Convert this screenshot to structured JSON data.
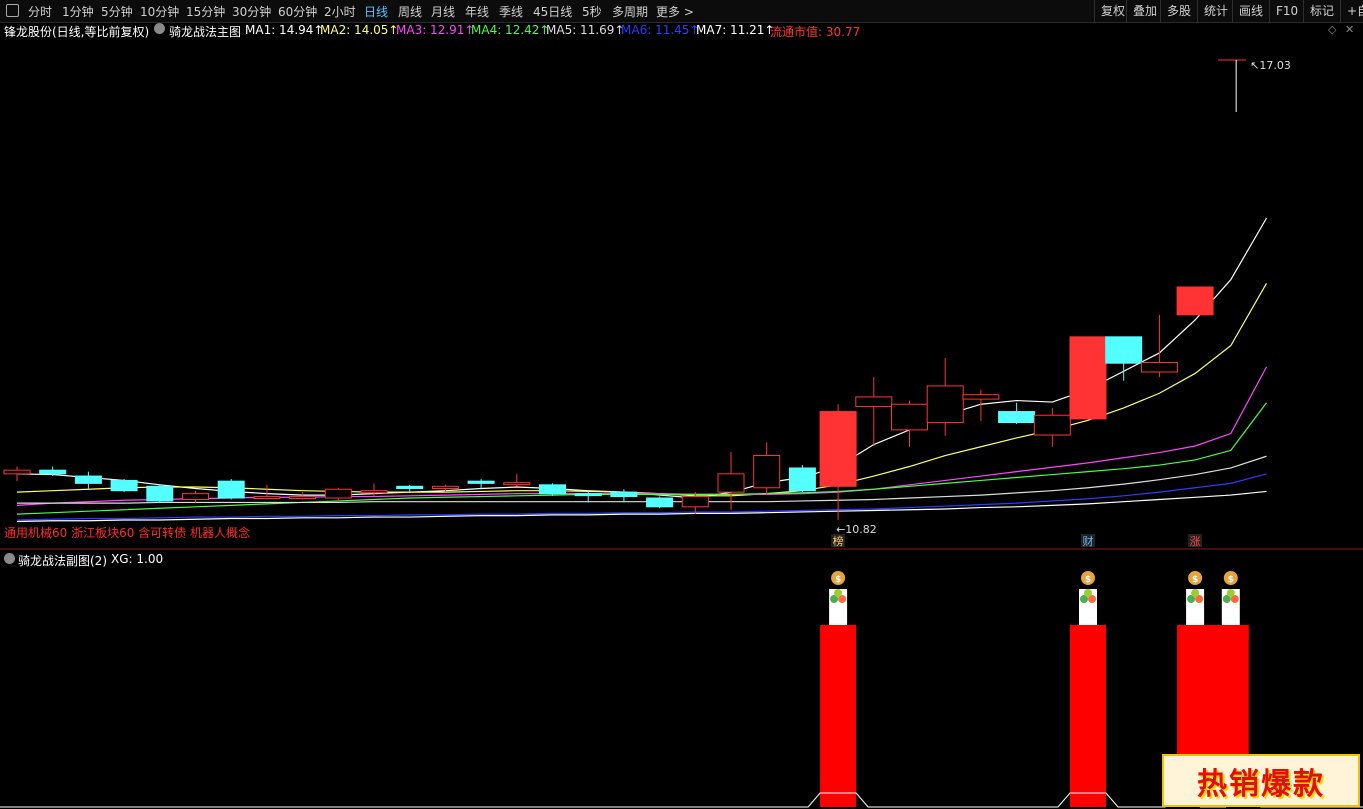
{
  "toolbar": {
    "periods": [
      "分时",
      "1分钟",
      "5分钟",
      "10分钟",
      "15分钟",
      "30分钟",
      "60分钟",
      "2小时",
      "日线",
      "周线",
      "月线",
      "年线",
      "季线",
      "45日线",
      "5秒",
      "多周期",
      "更多 >"
    ],
    "active_period": "日线",
    "right_buttons": [
      "复权",
      "叠加",
      "多股",
      "统计",
      "画线",
      "F10",
      "标记",
      "+自"
    ]
  },
  "info_bar": {
    "stock_title": "锋龙股份(日线,等比前复权)",
    "indicator_name": "骑龙战法主图",
    "ma": [
      {
        "label": "MA1: 14.94↑",
        "color": "#ffffff"
      },
      {
        "label": "MA2: 14.05↑",
        "color": "#ffff66"
      },
      {
        "label": "MA3: 12.91↑",
        "color": "#ff44ff"
      },
      {
        "label": "MA4: 12.42↑",
        "color": "#44ff44"
      },
      {
        "label": "MA5: 11.69↑",
        "color": "#dddddd"
      },
      {
        "label": "MA6: 11.45↑",
        "color": "#2a3cff"
      },
      {
        "label": "MA7: 11.21↑",
        "color": "#ffffff"
      },
      {
        "label": "流通市值: 30.77",
        "color": "#ff3333"
      }
    ]
  },
  "main_chart": {
    "concepts_text": "通用机械60 浙江板块60 含可转债 机器人概念",
    "high_label": "17.03",
    "low_label": "10.82",
    "markers": [
      {
        "text": "榜",
        "index": 23
      },
      {
        "text": "财",
        "index": 30
      },
      {
        "text": "涨",
        "index": 33
      }
    ]
  },
  "sub_header": {
    "title": "骑龙战法副图(2)",
    "xg_label": "XG: 1.00"
  },
  "badge": {
    "text": "热销爆款"
  },
  "colors": {
    "up": "#ff3333",
    "down": "#54ffff",
    "bar_red": "#ff0000"
  },
  "chart_data": [
    {
      "type": "candlestick",
      "title": "骑龙战法主图",
      "ylim": [
        10.5,
        17.3
      ],
      "candles": [
        {
          "o": 11.45,
          "h": 11.55,
          "l": 11.35,
          "c": 11.5
        },
        {
          "o": 11.5,
          "h": 11.55,
          "l": 11.42,
          "c": 11.45
        },
        {
          "o": 11.42,
          "h": 11.48,
          "l": 11.25,
          "c": 11.32
        },
        {
          "o": 11.36,
          "h": 11.38,
          "l": 11.2,
          "c": 11.22
        },
        {
          "o": 11.28,
          "h": 11.3,
          "l": 11.05,
          "c": 11.08
        },
        {
          "o": 11.1,
          "h": 11.22,
          "l": 11.05,
          "c": 11.18
        },
        {
          "o": 11.35,
          "h": 11.38,
          "l": 11.1,
          "c": 11.12
        },
        {
          "o": 11.12,
          "h": 11.3,
          "l": 11.1,
          "c": 11.14
        },
        {
          "o": 11.12,
          "h": 11.2,
          "l": 11.1,
          "c": 11.14
        },
        {
          "o": 11.12,
          "h": 11.26,
          "l": 11.08,
          "c": 11.24
        },
        {
          "o": 11.22,
          "h": 11.32,
          "l": 11.15,
          "c": 11.22
        },
        {
          "o": 11.28,
          "h": 11.3,
          "l": 11.2,
          "c": 11.25
        },
        {
          "o": 11.25,
          "h": 11.3,
          "l": 11.2,
          "c": 11.28
        },
        {
          "o": 11.35,
          "h": 11.38,
          "l": 11.25,
          "c": 11.32
        },
        {
          "o": 11.33,
          "h": 11.45,
          "l": 11.28,
          "c": 11.33
        },
        {
          "o": 11.3,
          "h": 11.32,
          "l": 11.15,
          "c": 11.18
        },
        {
          "o": 11.18,
          "h": 11.22,
          "l": 11.06,
          "c": 11.17
        },
        {
          "o": 11.2,
          "h": 11.24,
          "l": 11.06,
          "c": 11.14
        },
        {
          "o": 11.12,
          "h": 11.14,
          "l": 10.98,
          "c": 11.0
        },
        {
          "o": 11.0,
          "h": 11.2,
          "l": 10.9,
          "c": 11.14
        },
        {
          "o": 11.2,
          "h": 11.75,
          "l": 10.96,
          "c": 11.45
        },
        {
          "o": 11.26,
          "h": 11.88,
          "l": 11.16,
          "c": 11.7
        },
        {
          "o": 11.53,
          "h": 11.57,
          "l": 11.2,
          "c": 11.22
        },
        {
          "o": 11.28,
          "h": 12.4,
          "l": 10.82,
          "c": 12.3
        },
        {
          "o": 12.37,
          "h": 12.77,
          "l": 11.83,
          "c": 12.5
        },
        {
          "o": 12.05,
          "h": 12.45,
          "l": 11.82,
          "c": 12.4
        },
        {
          "o": 12.15,
          "h": 13.03,
          "l": 11.97,
          "c": 12.65
        },
        {
          "o": 12.47,
          "h": 12.6,
          "l": 12.17,
          "c": 12.53
        },
        {
          "o": 12.3,
          "h": 12.42,
          "l": 12.13,
          "c": 12.15
        },
        {
          "o": 11.98,
          "h": 12.35,
          "l": 11.82,
          "c": 12.25
        },
        {
          "o": 12.2,
          "h": 13.32,
          "l": 12.2,
          "c": 13.32
        },
        {
          "o": 13.32,
          "h": 13.32,
          "l": 12.72,
          "c": 12.96
        },
        {
          "o": 12.84,
          "h": 13.62,
          "l": 12.77,
          "c": 12.97
        },
        {
          "o": 13.62,
          "h": 14.0,
          "l": 13.62,
          "c": 14.0
        }
      ],
      "post_high": 17.03,
      "ma_series": [
        {
          "name": "MA1",
          "color": "#ffffff",
          "values": [
            11.45,
            11.44,
            11.4,
            11.36,
            11.3,
            11.25,
            11.21,
            11.18,
            11.16,
            11.16,
            11.18,
            11.2,
            11.22,
            11.25,
            11.27,
            11.25,
            11.22,
            11.2,
            11.16,
            11.12,
            11.2,
            11.33,
            11.4,
            11.55,
            11.85,
            12.05,
            12.25,
            12.4,
            12.45,
            12.43,
            12.6,
            12.85,
            13.1,
            13.55,
            14.1,
            14.94
          ]
        },
        {
          "name": "MA2",
          "color": "#ffff66",
          "values": [
            11.2,
            11.22,
            11.24,
            11.26,
            11.27,
            11.27,
            11.26,
            11.24,
            11.22,
            11.21,
            11.2,
            11.2,
            11.2,
            11.21,
            11.22,
            11.22,
            11.21,
            11.2,
            11.18,
            11.15,
            11.15,
            11.18,
            11.22,
            11.3,
            11.42,
            11.55,
            11.7,
            11.82,
            11.94,
            12.05,
            12.18,
            12.35,
            12.55,
            12.82,
            13.2,
            14.05
          ]
        },
        {
          "name": "MA3",
          "color": "#ff44ff",
          "values": [
            11.02,
            11.05,
            11.07,
            11.09,
            11.1,
            11.11,
            11.12,
            11.13,
            11.13,
            11.14,
            11.14,
            11.15,
            11.16,
            11.17,
            11.18,
            11.18,
            11.18,
            11.18,
            11.18,
            11.17,
            11.17,
            11.17,
            11.18,
            11.2,
            11.24,
            11.3,
            11.36,
            11.42,
            11.48,
            11.54,
            11.6,
            11.67,
            11.74,
            11.83,
            12.0,
            12.91
          ]
        },
        {
          "name": "MA4",
          "color": "#44ff44",
          "values": [
            10.9,
            10.92,
            10.94,
            10.96,
            10.98,
            11.0,
            11.02,
            11.04,
            11.06,
            11.08,
            11.1,
            11.12,
            11.13,
            11.14,
            11.15,
            11.16,
            11.17,
            11.17,
            11.17,
            11.17,
            11.17,
            11.18,
            11.19,
            11.21,
            11.24,
            11.28,
            11.32,
            11.36,
            11.4,
            11.44,
            11.48,
            11.52,
            11.57,
            11.64,
            11.77,
            12.42
          ]
        },
        {
          "name": "MA5",
          "color": "#dddddd",
          "values": [
            11.05,
            11.05,
            11.05,
            11.05,
            11.06,
            11.06,
            11.06,
            11.06,
            11.06,
            11.06,
            11.07,
            11.07,
            11.07,
            11.07,
            11.07,
            11.07,
            11.07,
            11.07,
            11.07,
            11.07,
            11.07,
            11.07,
            11.08,
            11.09,
            11.1,
            11.12,
            11.14,
            11.16,
            11.19,
            11.22,
            11.26,
            11.31,
            11.37,
            11.44,
            11.53,
            11.69
          ]
        },
        {
          "name": "MA6",
          "color": "#2a3cff",
          "values": [
            10.82,
            10.83,
            10.84,
            10.84,
            10.85,
            10.86,
            10.86,
            10.87,
            10.87,
            10.88,
            10.88,
            10.89,
            10.89,
            10.9,
            10.9,
            10.91,
            10.91,
            10.92,
            10.92,
            10.93,
            10.93,
            10.94,
            10.95,
            10.96,
            10.97,
            10.99,
            11.01,
            11.03,
            11.05,
            11.08,
            11.11,
            11.15,
            11.2,
            11.26,
            11.32,
            11.45
          ]
        },
        {
          "name": "MA7",
          "color": "#ffffff",
          "values": [
            10.8,
            10.81,
            10.81,
            10.82,
            10.82,
            10.83,
            10.84,
            10.84,
            10.85,
            10.85,
            10.86,
            10.86,
            10.87,
            10.88,
            10.88,
            10.89,
            10.89,
            10.9,
            10.9,
            10.91,
            10.91,
            10.92,
            10.93,
            10.94,
            10.95,
            10.96,
            10.97,
            10.99,
            11.0,
            11.02,
            11.04,
            11.07,
            11.1,
            11.13,
            11.16,
            11.21
          ]
        }
      ]
    },
    {
      "type": "bar",
      "title": "骑龙战法副图(2)",
      "signal_indices": [
        23,
        30,
        33,
        34
      ],
      "values": [
        0,
        0,
        0,
        0,
        0,
        0,
        0,
        0,
        0,
        0,
        0,
        0,
        0,
        0,
        0,
        0,
        0,
        0,
        0,
        0,
        0,
        0,
        0,
        1,
        0,
        0,
        0,
        0,
        0,
        0,
        1,
        0,
        0,
        1,
        1
      ],
      "ylim": [
        0,
        1
      ]
    }
  ]
}
